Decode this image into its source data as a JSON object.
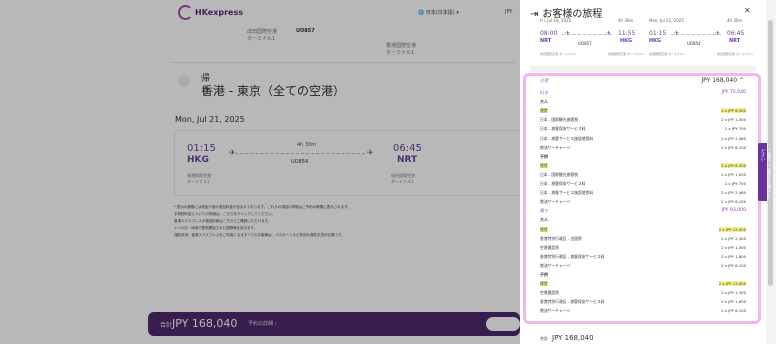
{
  "header": {
    "logo": "HKexpress",
    "language": "日本(日本語)",
    "currency": "JPY"
  },
  "outbound_segment": {
    "origin_airport": "成田国際空港",
    "origin_terminal": "ターミナル1",
    "flight_no": "UO857",
    "dest_airport": "香港国際空港",
    "dest_terminal": "ターミナル1"
  },
  "return": {
    "kicker": "帰り",
    "route": "香港 - 東京（全ての空港）",
    "date": "Mon, Jul 21, 2025"
  },
  "return_card": {
    "dep_time": "01:15",
    "dep_code": "HKG",
    "duration": "4h 30m",
    "flight_no": "UO854",
    "arr_time": "06:45",
    "arr_code": "NRT",
    "dep_airport": "香港国際空港",
    "dep_terminal": "ターミナル1",
    "arr_airport": "成田国際空港",
    "arr_terminal": "ターミナル1"
  },
  "notes": [
    "* 表示の価格には税金や他の追加料金が含まれております。これらの項目の詳細はご予約の概要に表示されます。",
    "手荷物料金についての詳細は、こちらをクリックしてください。",
    "香港エクスプレスの運送約款はこちらでご確認いただけます。",
    "1～10日：地域で販売開始された国際線を除きます。",
    "運航状況：香港エクスプレスをご利用になるすべてのお客様は、パスポートなど有効な渡航文書が必要です。"
  ],
  "total_bar": {
    "label": "合計",
    "amount": "JPY 168,040",
    "details": "予約の詳細"
  },
  "panel": {
    "title": "お客様の旅程",
    "outbound_flight": {
      "date": "Fri, Jul 18, 2025",
      "duration": "4h 30m",
      "dep_time": "08:00",
      "dep_code": "NRT",
      "arr_time": "11:55",
      "arr_code": "HKG",
      "flight_no": "UO857",
      "dep_airport": "成田国際空港 ターミナル1",
      "arr_airport": "香港国際空港 ターミナル1"
    },
    "return_flight": {
      "date": "Mon, Jul 21, 2025",
      "duration": "4h 30m",
      "dep_time": "01:15",
      "dep_code": "HKG",
      "arr_time": "06:45",
      "arr_code": "NRT",
      "flight_no": "UO854",
      "dep_airport": "香港国際空港 ターミナル1",
      "arr_airport": "成田国際空港 ターミナル1"
    },
    "subtotal_label": "小計",
    "subtotal_value": "JPY 168,040",
    "rows": [
      {
        "l": "行き",
        "r": "JPY 75,040",
        "kind": "sec"
      },
      {
        "l": "大人",
        "r": "",
        "kind": "sub"
      },
      {
        "l": "運賃",
        "r": "2 x JPY 6,500",
        "kind": "hi"
      },
      {
        "l": "日本 - 国際観光旅客税",
        "r": "2 x JPY 1,000",
        "kind": ""
      },
      {
        "l": "日本 - 旅客保安サービス料",
        "r": "2 x JPY 700",
        "kind": ""
      },
      {
        "l": "日本 - 旅客サービス施設使用料",
        "r": "2 x JPY 2,460",
        "kind": ""
      },
      {
        "l": "燃油サーチャージ",
        "r": "2 x JPY 6,100",
        "kind": ""
      },
      {
        "l": "子供",
        "r": "",
        "kind": "sub"
      },
      {
        "l": "運賃",
        "r": "2 x JPY 6,500",
        "kind": "hi"
      },
      {
        "l": "日本 - 国際観光旅客税",
        "r": "2 x JPY 1,000",
        "kind": ""
      },
      {
        "l": "日本 - 旅客保安サービス料",
        "r": "2 x JPY 700",
        "kind": ""
      },
      {
        "l": "日本 - 旅客サービス施設使用料",
        "r": "2 x JPY 2,460",
        "kind": ""
      },
      {
        "l": "燃油サーチャージ",
        "r": "2 x JPY 6,100",
        "kind": ""
      },
      {
        "l": "帰り",
        "r": "JPY 93,000",
        "kind": "sec"
      },
      {
        "l": "大人",
        "r": "",
        "kind": "sub"
      },
      {
        "l": "運賃",
        "r": "2 x JPY 13,000",
        "kind": "hi"
      },
      {
        "l": "香港特別行政区 - 出国税",
        "r": "2 x JPY 2,300",
        "kind": ""
      },
      {
        "l": "空港建設費",
        "r": "2 x JPY 1,300",
        "kind": ""
      },
      {
        "l": "香港特別行政区 - 旅客保安サービス料",
        "r": "2 x JPY 1,800",
        "kind": ""
      },
      {
        "l": "燃油サーチャージ",
        "r": "2 x JPY 6,100",
        "kind": ""
      },
      {
        "l": "子供",
        "r": "",
        "kind": "sub"
      },
      {
        "l": "運賃",
        "r": "2 x JPY 13,000",
        "kind": "hi"
      },
      {
        "l": "空港建設費",
        "r": "2 x JPY 1,300",
        "kind": ""
      },
      {
        "l": "香港特別行政区 - 旅客保安サービス料",
        "r": "2 x JPY 1,800",
        "kind": ""
      },
      {
        "l": "燃油サーチャージ",
        "r": "2 x JPY 6,100",
        "kind": ""
      }
    ],
    "total_label": "合計",
    "total_value": "JPY 168,040"
  },
  "side_tab": "ご意見・ご感想をお聞かせください"
}
